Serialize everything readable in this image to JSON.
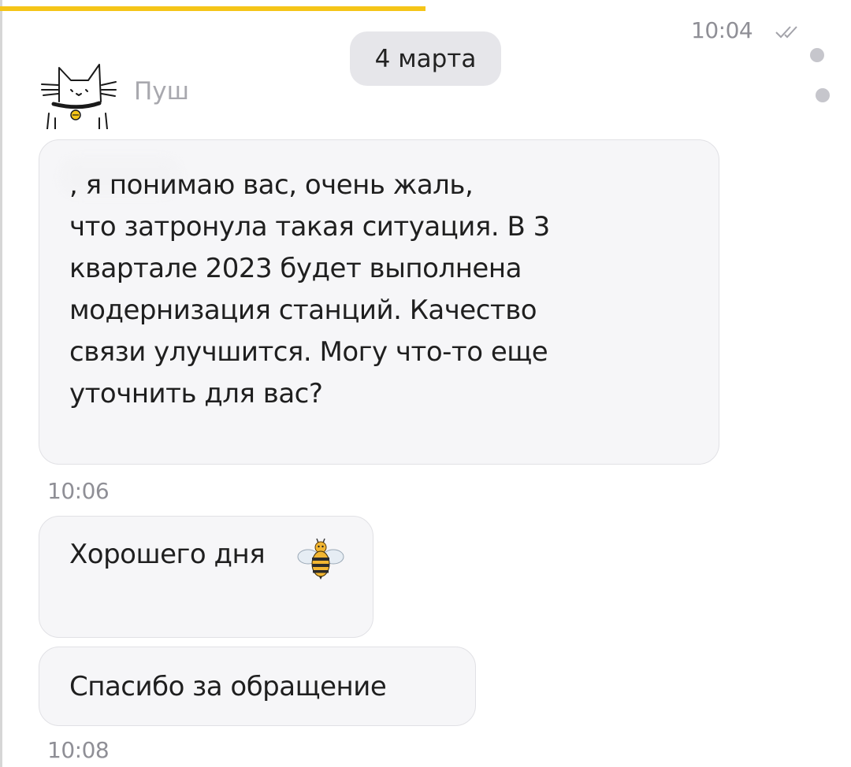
{
  "status": {
    "sent_time": "10:04"
  },
  "date_separator": "4 марта",
  "sender": {
    "name": "Пуш",
    "avatar_icon": "cat-icon"
  },
  "messages": [
    {
      "text": ", я понимаю вас, очень жаль,\nчто затронула такая ситуация. В 3\nквартале 2023 будет выполнена\nмодернизация станций. Качество\nсвязи улучшится. Могу что-то еще\nуточнить для вас?",
      "time": "10:06"
    },
    {
      "text": "Хорошего дня",
      "emoji_icon": "bee-icon"
    },
    {
      "text": "Спасибо за обращение",
      "time": "10:08"
    }
  ],
  "colors": {
    "accent": "#f5c518",
    "bubble_bg": "#f6f6f8",
    "date_chip_bg": "#e6e6ea",
    "muted_text": "#8f8f96"
  }
}
